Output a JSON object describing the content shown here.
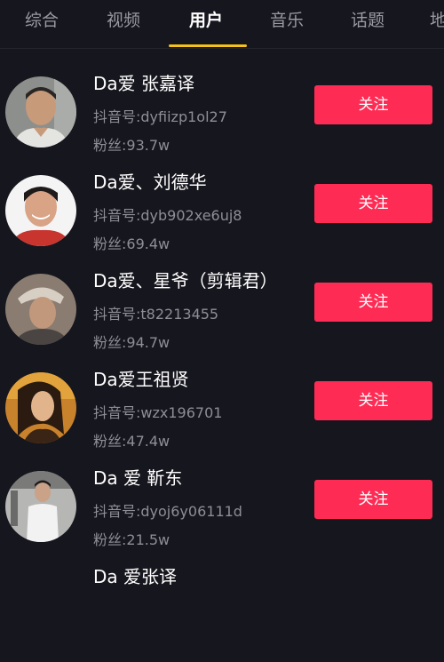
{
  "tabs": [
    {
      "label": "综合"
    },
    {
      "label": "视频"
    },
    {
      "label": "用户"
    },
    {
      "label": "音乐"
    },
    {
      "label": "话题"
    },
    {
      "label": "地"
    }
  ],
  "active_tab": "用户",
  "colors": {
    "background": "#16161e",
    "tab_indicator": "#f7c21b",
    "follow_button": "#fe2c55",
    "secondary_text": "#8e8e96"
  },
  "users": [
    {
      "name": "Da爱 张嘉译",
      "douyin_id": "抖音号:dyfiizp1ol27",
      "fans": "粉丝:93.7w",
      "follow_label": "关注"
    },
    {
      "name": "Da爱、刘德华",
      "douyin_id": "抖音号:dyb902xe6uj8",
      "fans": "粉丝:69.4w",
      "follow_label": "关注"
    },
    {
      "name": "Da爱、星爷（剪辑君）",
      "douyin_id": "抖音号:t82213455",
      "fans": "粉丝:94.7w",
      "follow_label": "关注"
    },
    {
      "name": "Da爱王祖贤",
      "douyin_id": "抖音号:wzx196701",
      "fans": "粉丝:47.4w",
      "follow_label": "关注"
    },
    {
      "name": "Da 爱 靳东",
      "douyin_id": "抖音号:dyoj6y06111d",
      "fans": "粉丝:21.5w",
      "follow_label": "关注"
    },
    {
      "name": "Da 爱张译"
    }
  ]
}
